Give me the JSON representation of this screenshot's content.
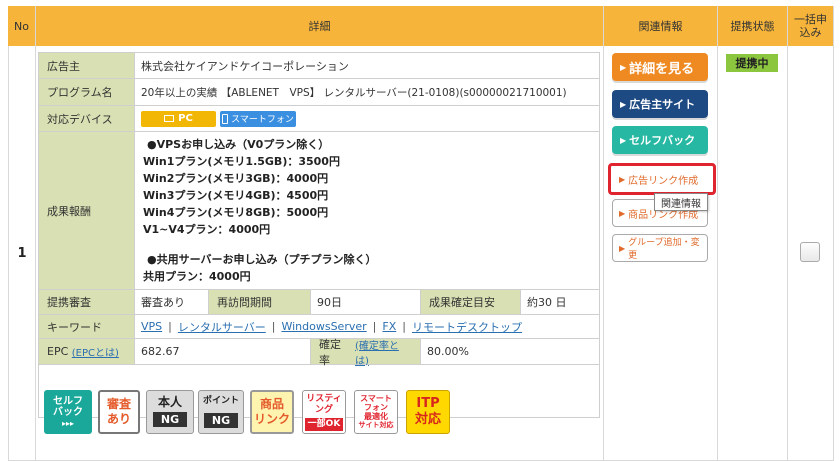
{
  "header": {
    "no": "No",
    "detail": "詳細",
    "related": "関連情報",
    "status": "提携状態",
    "bulk": "一括申込み"
  },
  "row": {
    "number": "1",
    "advertiser_label": "広告主",
    "advertiser": "株式会社ケイアンドケイコーポレーション",
    "program_label": "プログラム名",
    "program": "20年以上の実績 【ABLENET　VPS】 レンタルサーバー(21-0108)(s00000021710001)",
    "device_label": "対応デバイス",
    "device_pc": "PC",
    "device_sp": "スマートフォン",
    "reward_label": "成果報酬",
    "reward_lines": {
      "l1": "●VPSお申し込み（V0プラン除く）",
      "l2": "Win1プラン(メモリ1.5GB)：3500円",
      "l3": "Win2プラン(メモリ3GB)：4000円",
      "l4": "Win3プラン(メモリ4GB)：4500円",
      "l5": "Win4プラン(メモリ8GB)：5000円",
      "l6": "V1~V4プラン：4000円",
      "l7": "●共用サーバーお申し込み（プチプラン除く）",
      "l8": "共用プラン：4000円"
    },
    "review_label": "提携審査",
    "review": "審査あり",
    "revisit_label": "再訪問期間",
    "revisit": "90日",
    "confirm_label": "成果確定目安",
    "confirm": "約30 日",
    "keyword_label": "キーワード",
    "keywords": {
      "k1": "VPS",
      "k2": "レンタルサーバー",
      "k3": "WindowsServer",
      "k4": "FX",
      "k5": "リモートデスクトップ"
    },
    "epc_label": "EPC",
    "epc_link": "(EPCとは)",
    "epc": "682.67",
    "rate_label": "確定率",
    "rate_link": "(確定率とは)",
    "rate": "80.00%",
    "badges": {
      "selfback_1": "セルフ",
      "selfback_2": "バック",
      "selfback_3": "▸▸▸",
      "review_1": "審査",
      "review_2": "あり",
      "person_1": "本人",
      "person_2": "NG",
      "point_1": "ポイント",
      "point_2": "NG",
      "product_1": "商品",
      "product_2": "リンク",
      "listing_1": "リスティ",
      "listing_2": "ング",
      "listing_3": "一部OK",
      "smart_1": "スマート",
      "smart_2": "フォン",
      "smart_3": "最適化",
      "smart_4": "サイト対応",
      "itp_1": "ITP",
      "itp_2": "対応"
    },
    "buttons": {
      "detail": "詳細を見る",
      "advertiser_site": "広告主サイト",
      "selfback": "セルフバック",
      "ad_link": "広告リンク作成",
      "product_link": "商品リンク作成",
      "tooltip": "関連情報",
      "group": "グループ追加・変更"
    },
    "status": "提携中"
  },
  "colors": {
    "header": "#f6b43a",
    "label_bg": "#d9e0b3",
    "orange_btn": "#ef8a23",
    "navy_btn": "#1d4a82",
    "teal_btn": "#27b8a3",
    "status_green": "#8cc63f",
    "highlight_red": "#e0242f"
  }
}
